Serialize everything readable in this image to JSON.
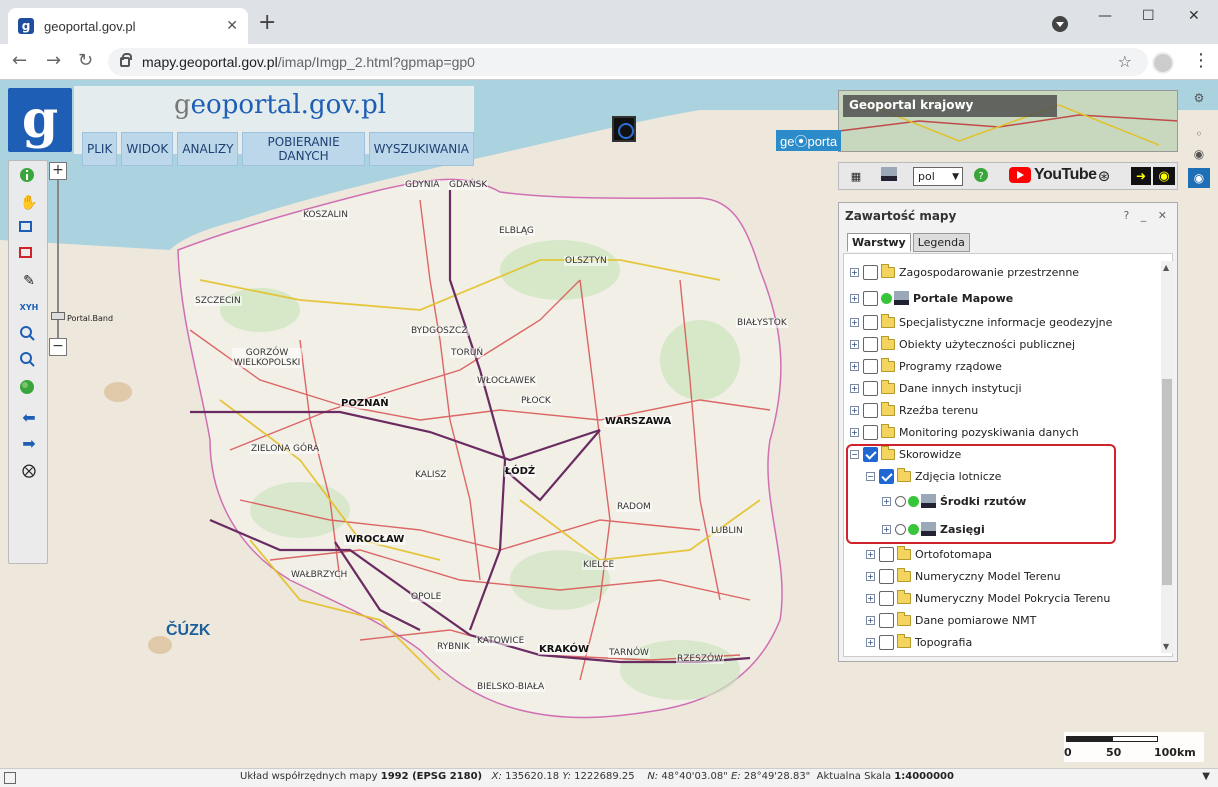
{
  "browser": {
    "tab_title": "geoportal.gov.pl",
    "favicon_glyph": "g",
    "new_tab": "+",
    "url_host": "mapy.geoportal.gov.pl",
    "url_path": "/imap/Imgp_2.html?gpmap=gp0"
  },
  "header": {
    "site_title_prefix": "g",
    "site_title": "eoportal.gov.pl",
    "logo_glyph": "g",
    "menu": [
      "PLIK",
      "WIDOK",
      "ANALIZY",
      "POBIERANIE DANYCH",
      "WYSZUKIWANIA"
    ]
  },
  "zoom": {
    "plus": "+",
    "minus": "−",
    "handle_label": "Portal.Band"
  },
  "map_labels": {
    "cities": [
      {
        "name": "GDYNIA"
      },
      {
        "name": "GDAŃSK"
      },
      {
        "name": "KOSZALIN"
      },
      {
        "name": "ELBLĄG"
      },
      {
        "name": "OLSZTYN"
      },
      {
        "name": "SZCZECIN"
      },
      {
        "name": "BYDGOSZCZ"
      },
      {
        "name": "TORUŃ"
      },
      {
        "name": "BIAŁYSTOK"
      },
      {
        "name": "GORZÓW WIELKOPOLSKI"
      },
      {
        "name": "WŁOCŁAWEK"
      },
      {
        "name": "PŁOCK"
      },
      {
        "name": "POZNAŃ"
      },
      {
        "name": "WARSZAWA"
      },
      {
        "name": "ZIELONA GÓRA"
      },
      {
        "name": "ŁÓDŹ"
      },
      {
        "name": "KALISZ"
      },
      {
        "name": "RADOM"
      },
      {
        "name": "LUBLIN"
      },
      {
        "name": "WROCŁAW"
      },
      {
        "name": "KIELCE"
      },
      {
        "name": "WAŁBRZYCH"
      },
      {
        "name": "OPOLE"
      },
      {
        "name": "KATOWICE"
      },
      {
        "name": "RYBNIK"
      },
      {
        "name": "KRAKÓW"
      },
      {
        "name": "TARNÓW"
      },
      {
        "name": "RZESZÓW"
      },
      {
        "name": "BIELSKO-BIAŁA"
      }
    ],
    "uzk": "ČÚZK"
  },
  "right": {
    "thumb_label": "Geoportal krajowy",
    "geoportal_tag": "ge⦿porta",
    "lang": "pol",
    "youtube": "YouTube",
    "help": "?"
  },
  "layers_panel": {
    "title": "Zawartość mapy",
    "controls": "? _ ✕",
    "tabs": [
      "Warstwy",
      "Legenda"
    ],
    "items": [
      {
        "label": "Zagospodarowanie przestrzenne",
        "bold": false
      },
      {
        "label": "Portale Mapowe",
        "bold": true
      },
      {
        "label": "Specjalistyczne informacje geodezyjne",
        "bold": false
      },
      {
        "label": "Obiekty użyteczności publicznej",
        "bold": false
      },
      {
        "label": "Programy rządowe",
        "bold": false
      },
      {
        "label": "Dane innych instytucji",
        "bold": false
      },
      {
        "label": "Rzeźba terenu",
        "bold": false
      },
      {
        "label": "Monitoring pozyskiwania danych",
        "bold": false
      },
      {
        "label": "Skorowidze",
        "bold": false
      },
      {
        "label": "Zdjęcia lotnicze",
        "bold": false
      },
      {
        "label": "Środki rzutów",
        "bold": true
      },
      {
        "label": "Zasięgi",
        "bold": true
      },
      {
        "label": "Ortofotomapa",
        "bold": false
      },
      {
        "label": "Numeryczny Model Terenu",
        "bold": false
      },
      {
        "label": "Numeryczny Model Pokrycia Terenu",
        "bold": false
      },
      {
        "label": "Dane pomiarowe NMT",
        "bold": false
      },
      {
        "label": "Topografia",
        "bold": false
      }
    ]
  },
  "scale": {
    "labels": [
      "0",
      "50",
      "100km"
    ]
  },
  "status": {
    "coord_label": "Układ współrzędnych mapy",
    "coord_system": "1992 (EPSG 2180)",
    "x_label": "X:",
    "x_value": "135620.18",
    "y_label": "Y:",
    "y_value": "1222689.25",
    "n_label": "N:",
    "n_value": "48°40'03.08\"",
    "e_label": "E:",
    "e_value": "28°49'28.83\"",
    "scale_label": "Aktualna Skala",
    "scale_value": "1:4000000"
  },
  "colors": {
    "brand_blue": "#1e5fb5",
    "menu_bg": "#bcd7ea",
    "highlight_red": "#d0222a",
    "checkbox_blue": "#1f68d4"
  }
}
